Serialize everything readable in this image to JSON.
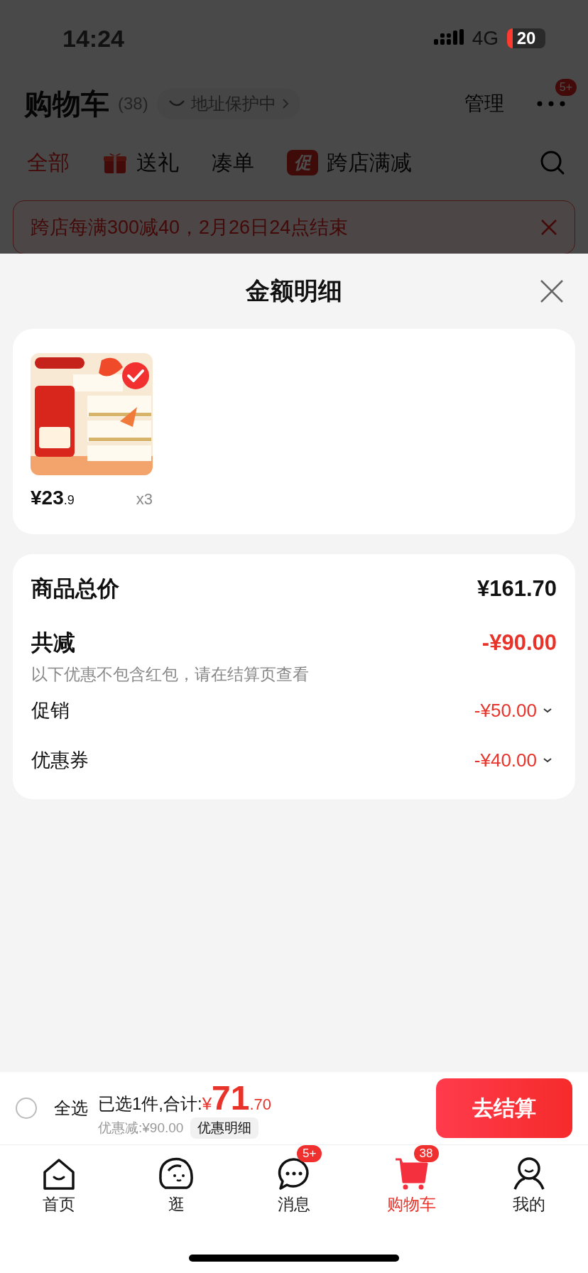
{
  "status_bar": {
    "time": "14:24",
    "network": "4G",
    "battery": "20"
  },
  "header": {
    "title": "购物车",
    "count": "(38)",
    "address_chip": "地址保护中",
    "manage": "管理",
    "more_badge": "5+"
  },
  "filter_tabs": [
    {
      "label": "全部",
      "selected": true,
      "kind": "plain"
    },
    {
      "label": "送礼",
      "selected": false,
      "kind": "gift"
    },
    {
      "label": "凑单",
      "selected": false,
      "kind": "plain"
    },
    {
      "label": "跨店满减",
      "selected": false,
      "kind": "badge",
      "badge": "促"
    }
  ],
  "promo_banner": {
    "text": "跨店每满300减40，2月26日24点结束"
  },
  "sheet": {
    "title": "金额明细"
  },
  "items": [
    {
      "kind": "picture",
      "price_main": "¥23",
      "price_decimal": ".9",
      "quantity": "x3"
    }
  ],
  "summary": {
    "total_label": "商品总价",
    "total_value": "¥161.70",
    "discount_label": "共减",
    "discount_value": "-¥90.00",
    "note": "以下优惠不包含红包，请在结算页查看",
    "details": [
      {
        "label": "促销",
        "value": "-¥50.00"
      },
      {
        "label": "优惠券",
        "value": "-¥40.00"
      }
    ]
  },
  "checkout": {
    "select_all": {
      "label": "全选",
      "checked": false
    },
    "selected_text": "已选1件,合计:",
    "currency": "¥",
    "amount_main": "71",
    "amount_decimal": ".70",
    "discount_text": "优惠减:¥90.00",
    "detail_button": "优惠明细",
    "button": "去结算"
  },
  "tab_bar": [
    {
      "label": "首页",
      "kind": "home",
      "selected": false
    },
    {
      "label": "逛",
      "kind": "browse",
      "selected": false
    },
    {
      "label": "消息",
      "kind": "message",
      "selected": false,
      "badge": "5+"
    },
    {
      "label": "购物车",
      "kind": "cart",
      "selected": true,
      "badge": "38"
    },
    {
      "label": "我的",
      "kind": "profile",
      "selected": false
    }
  ]
}
